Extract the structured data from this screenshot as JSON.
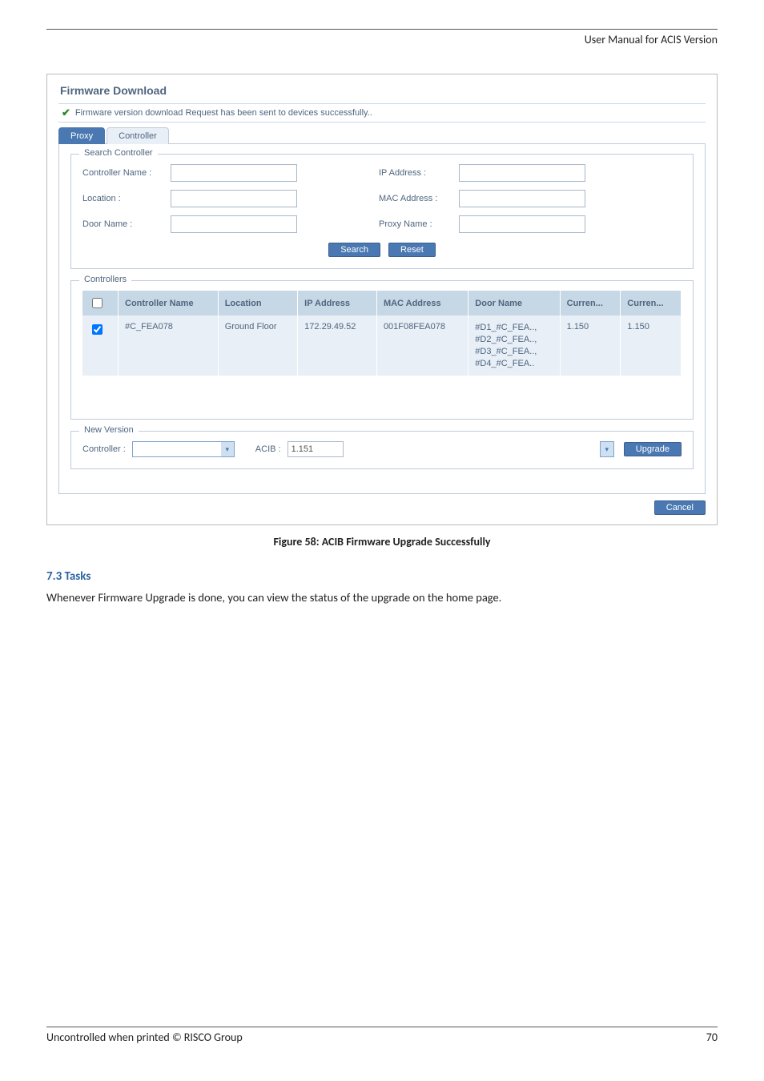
{
  "header": {
    "title": "User Manual for ACIS Version"
  },
  "screenshot": {
    "window_title": "Firmware Download",
    "alert": "Firmware version download Request has been sent to devices successfully..",
    "tabs": {
      "active": "Proxy",
      "inactive": "Controller"
    },
    "search_controller": {
      "legend": "Search Controller",
      "labels": {
        "controller_name": "Controller Name :",
        "ip_address": "IP Address :",
        "location": "Location :",
        "mac_address": "MAC Address :",
        "door_name": "Door Name :",
        "proxy_name": "Proxy Name :"
      },
      "buttons": {
        "search": "Search",
        "reset": "Reset"
      }
    },
    "controllers": {
      "legend": "Controllers",
      "headers": {
        "name": "Controller Name",
        "location": "Location",
        "ip": "IP Address",
        "mac": "MAC Address",
        "door": "Door Name",
        "cur1": "Curren...",
        "cur2": "Curren..."
      },
      "row": {
        "name": "#C_FEA078",
        "location": "Ground Floor",
        "ip": "172.29.49.52",
        "mac": "001F08FEA078",
        "doors": [
          "#D1_#C_FEA..,",
          "#D2_#C_FEA..,",
          "#D3_#C_FEA..,",
          "#D4_#C_FEA.."
        ],
        "cur1": "1.150",
        "cur2": "1.150"
      }
    },
    "new_version": {
      "legend": "New Version",
      "labels": {
        "controller": "Controller :",
        "acib": "ACIB :"
      },
      "acib_value": "1.151",
      "upgrade": "Upgrade"
    },
    "cancel": "Cancel"
  },
  "caption": "Figure 58: ACIB Firmware Upgrade Successfully",
  "section": {
    "heading": "7.3  Tasks",
    "text": "Whenever Firmware Upgrade is done, you can view the status of the upgrade on the home page."
  },
  "footer": {
    "left": "Uncontrolled when printed © RISCO Group",
    "right": "70"
  }
}
